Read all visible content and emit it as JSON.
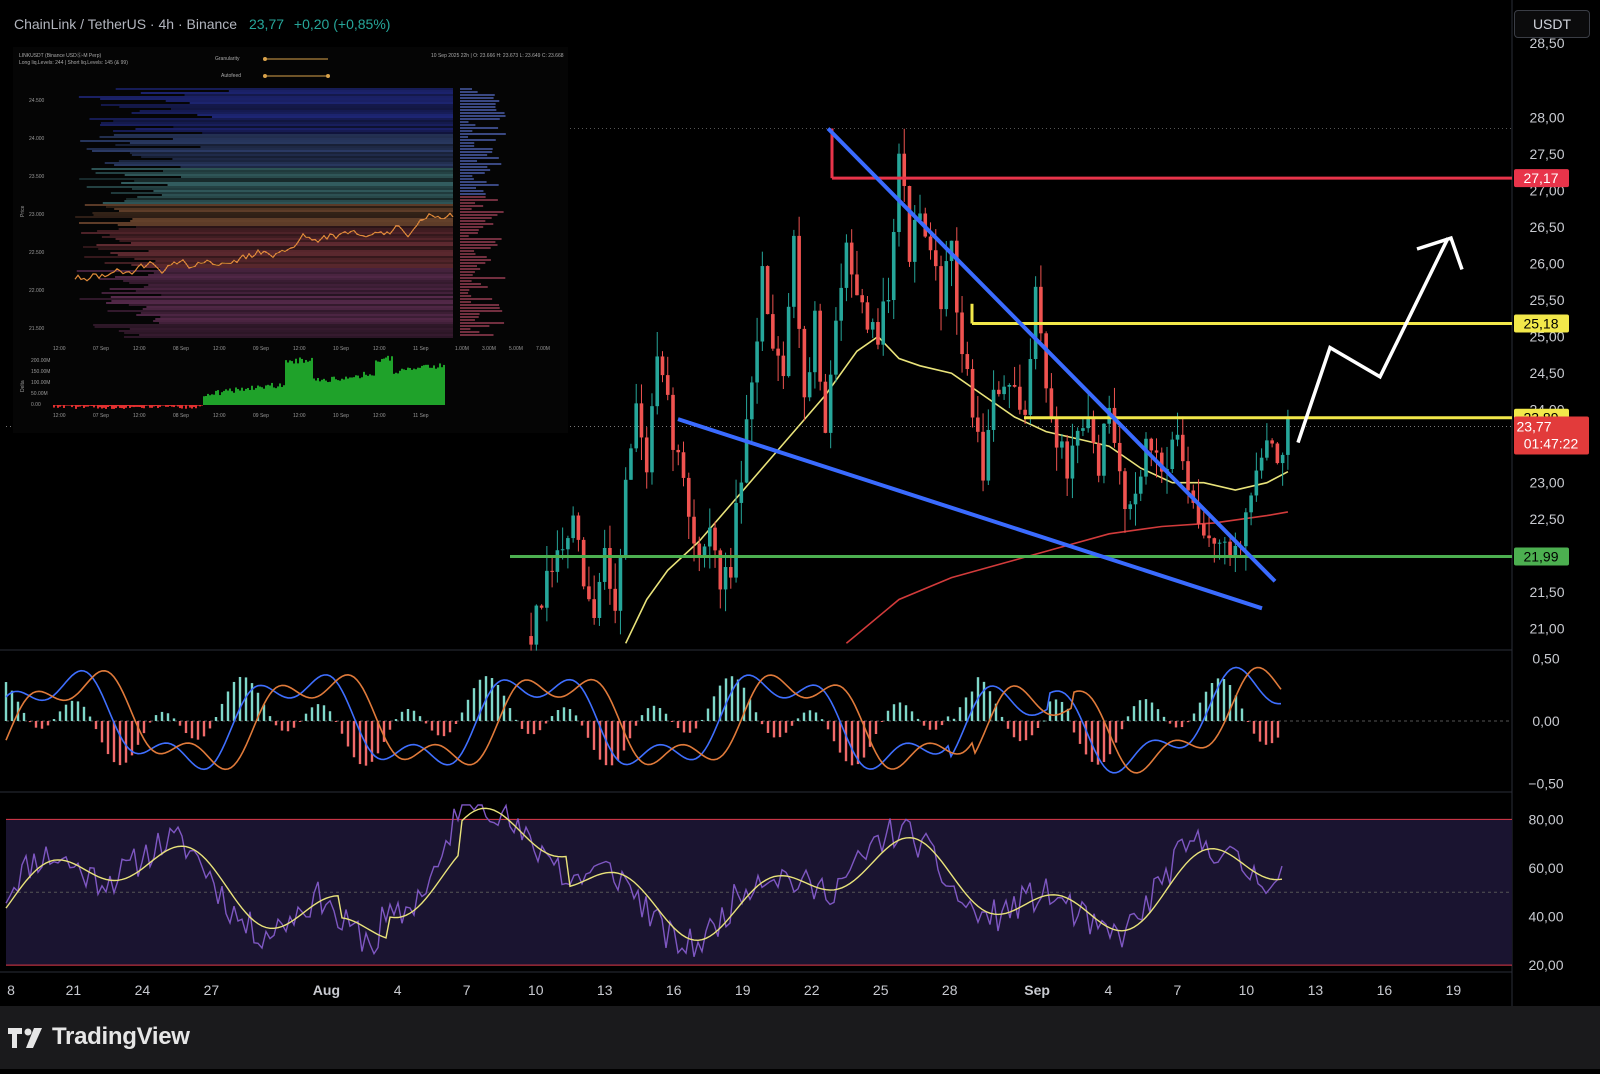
{
  "header": {
    "symbol": "ChainLink / TetherUS · 4h · Binance",
    "last": "23,77",
    "change": "+0,20 (+0,85%)"
  },
  "currency_button": "USDT",
  "brand": "TradingView",
  "colors": {
    "bull": "#26a69a",
    "bear": "#ef5350",
    "wedge": "#3a6bff",
    "resistance_red": "#e8344a",
    "resistance_yellow": "#f2e84a",
    "support_green": "#4caf50",
    "ma_fast": "#e9e37a",
    "ma_slow": "#d23b3b",
    "macd": "#3f6fff",
    "signal": "#e07a3a",
    "rsi": "#7e57c2",
    "rsi_ma": "#e9e37a"
  },
  "price_badges": {
    "r1": "27,17",
    "r2": "25,18",
    "r3": "23,89",
    "current": "23,77",
    "countdown": "01:47:22",
    "support": "21,99"
  },
  "inset": {
    "title_line1": "LINKUSDT (Binance USDⓈ-M Perp)",
    "title_line2": "Long liq.Levels: 244 | Short liq.Levels: 145 (& 99)",
    "legend1": "Granularity",
    "legend2": "Autofeed",
    "ohlc": "10 Sep 2025 22h | O: 23.666 H: 23.673 L: 23.649 C: 23.668",
    "price_ticks": [
      "24.500",
      "24.000",
      "23.500",
      "23.000",
      "22.500",
      "22.000",
      "21.500"
    ],
    "y_label": "Price",
    "delta_label": "Delta",
    "delta_ticks": [
      "200.00M",
      "150.00M",
      "100.00M",
      "50.00M",
      "0.00"
    ],
    "vol_ticks": [
      "1.00M",
      "3.00M",
      "5.00M",
      "7.00M"
    ],
    "x_ticks": [
      "12:00",
      "07 Sep",
      "12:00",
      "08 Sep",
      "12:00",
      "09 Sep",
      "12:00",
      "10 Sep",
      "12:00",
      "11 Sep"
    ]
  },
  "chart_data": [
    {
      "type": "candlestick",
      "title": "ChainLink / TetherUS · 4h · Binance",
      "y_ticks": [
        "28,00",
        "27,50",
        "27,00",
        "26,50",
        "26,00",
        "25,50",
        "25,00",
        "24,50",
        "24,00",
        "23,50",
        "23,00",
        "22,50",
        "22,00",
        "21,50",
        "21,00"
      ],
      "ylim": [
        20.75,
        28.35
      ],
      "x_ticks": [
        "8",
        "21",
        "24",
        "27",
        "Aug",
        "4",
        "7",
        "10",
        "13",
        "16",
        "19",
        "22",
        "25",
        "28",
        "Sep",
        "4",
        "7",
        "10",
        "13",
        "16",
        "19"
      ],
      "levels": [
        {
          "value": 27.17,
          "color": "red"
        },
        {
          "value": 25.18,
          "color": "yellow"
        },
        {
          "value": 23.89,
          "color": "yellow"
        },
        {
          "value": 21.99,
          "color": "green"
        }
      ],
      "last_price": 23.77,
      "wedge_upper": [
        {
          "x": "Aug 21 12:00",
          "y": 27.85
        },
        {
          "x": "Sep 11",
          "y": 21.65
        }
      ],
      "wedge_lower": [
        {
          "x": "Aug 16",
          "y": 23.87
        },
        {
          "x": "Sep 12",
          "y": 21.28
        }
      ],
      "projection": [
        {
          "x": "Sep 11",
          "y": 23.55
        },
        {
          "x": "Sep 12",
          "y": 24.9
        },
        {
          "x": "Sep 13",
          "y": 24.45
        },
        {
          "x": "Sep 15",
          "y": 26.2
        }
      ],
      "price_path": [
        [
          0,
          20.9
        ],
        [
          4,
          21.8
        ],
        [
          8,
          22.4
        ],
        [
          10,
          21.6
        ],
        [
          12,
          21.1
        ],
        [
          14,
          22.1
        ],
        [
          16,
          21.3
        ],
        [
          18,
          23.0
        ],
        [
          20,
          24.0
        ],
        [
          22,
          23.2
        ],
        [
          24,
          24.6
        ],
        [
          26,
          24.0
        ],
        [
          28,
          23.3
        ],
        [
          30,
          22.6
        ],
        [
          32,
          22.0
        ],
        [
          34,
          22.4
        ],
        [
          36,
          21.5
        ],
        [
          38,
          21.9
        ],
        [
          40,
          23.1
        ],
        [
          42,
          24.2
        ],
        [
          44,
          25.9
        ],
        [
          46,
          25.0
        ],
        [
          48,
          24.6
        ],
        [
          50,
          26.3
        ],
        [
          52,
          24.2
        ],
        [
          54,
          25.2
        ],
        [
          56,
          23.6
        ],
        [
          58,
          25.1
        ],
        [
          60,
          26.5
        ],
        [
          62,
          25.6
        ],
        [
          64,
          24.9
        ],
        [
          66,
          25.1
        ],
        [
          68,
          25.7
        ],
        [
          70,
          27.6
        ],
        [
          72,
          26.2
        ],
        [
          74,
          26.6
        ],
        [
          76,
          26.0
        ],
        [
          78,
          25.6
        ],
        [
          80,
          26.1
        ],
        [
          82,
          24.8
        ],
        [
          84,
          24.0
        ],
        [
          86,
          23.2
        ],
        [
          88,
          24.1
        ],
        [
          90,
          24.4
        ],
        [
          92,
          24.1
        ],
        [
          94,
          23.8
        ],
        [
          96,
          25.9
        ],
        [
          98,
          24.2
        ],
        [
          100,
          23.6
        ],
        [
          102,
          23.2
        ],
        [
          104,
          23.5
        ],
        [
          106,
          23.8
        ],
        [
          108,
          23.3
        ],
        [
          110,
          23.9
        ],
        [
          112,
          23.1
        ],
        [
          114,
          22.6
        ],
        [
          116,
          23.3
        ],
        [
          118,
          23.5
        ],
        [
          120,
          23.2
        ],
        [
          122,
          23.6
        ],
        [
          124,
          23.3
        ],
        [
          126,
          22.5
        ],
        [
          128,
          22.2
        ],
        [
          130,
          22.3
        ],
        [
          132,
          22.0
        ],
        [
          134,
          22.1
        ],
        [
          136,
          22.5
        ],
        [
          138,
          23.2
        ],
        [
          140,
          23.5
        ],
        [
          142,
          23.3
        ],
        [
          144,
          23.8
        ]
      ],
      "ma_fast": [
        [
          18,
          20.8
        ],
        [
          22,
          21.4
        ],
        [
          26,
          21.8
        ],
        [
          32,
          22.2
        ],
        [
          38,
          22.7
        ],
        [
          44,
          23.2
        ],
        [
          50,
          23.7
        ],
        [
          56,
          24.2
        ],
        [
          62,
          24.8
        ],
        [
          66,
          25.0
        ],
        [
          70,
          24.7
        ],
        [
          74,
          24.6
        ],
        [
          80,
          24.5
        ],
        [
          86,
          24.2
        ],
        [
          92,
          23.9
        ],
        [
          98,
          23.7
        ],
        [
          104,
          23.6
        ],
        [
          110,
          23.5
        ],
        [
          116,
          23.2
        ],
        [
          122,
          23.0
        ],
        [
          128,
          23.0
        ],
        [
          134,
          22.9
        ],
        [
          140,
          23.0
        ],
        [
          144,
          23.15
        ]
      ],
      "ma_slow": [
        [
          60,
          20.8
        ],
        [
          70,
          21.4
        ],
        [
          80,
          21.7
        ],
        [
          90,
          21.9
        ],
        [
          100,
          22.1
        ],
        [
          110,
          22.3
        ],
        [
          120,
          22.4
        ],
        [
          130,
          22.45
        ],
        [
          140,
          22.55
        ],
        [
          144,
          22.6
        ]
      ],
      "current_time_countdown": "01:47:22"
    },
    {
      "type": "macd",
      "y_ticks": [
        "0,50",
        "0,00",
        "−0,50"
      ],
      "ylim": [
        -0.55,
        0.55
      ]
    },
    {
      "type": "rsi",
      "y_ticks": [
        "80,00",
        "60,00",
        "40,00",
        "20,00"
      ],
      "ylim": [
        18,
        88
      ],
      "bands": [
        80,
        20
      ],
      "midline": 50
    }
  ]
}
